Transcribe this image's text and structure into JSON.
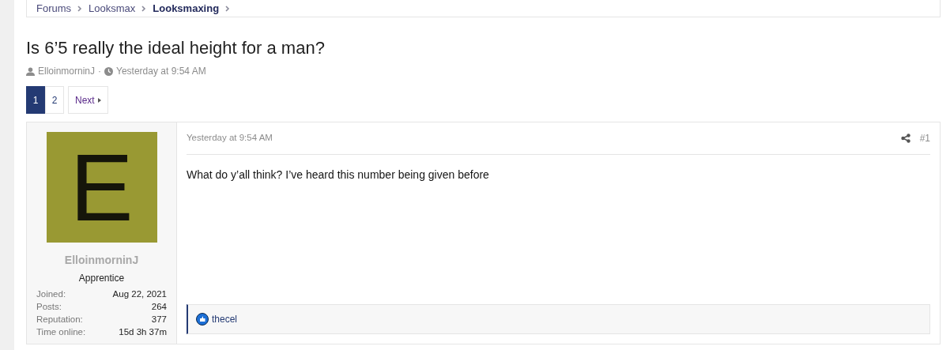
{
  "breadcrumbs": [
    {
      "label": "Forums",
      "selected": false
    },
    {
      "label": "Looksmax",
      "selected": false
    },
    {
      "label": "Looksmaxing",
      "selected": true
    }
  ],
  "thread": {
    "title": "Is 6’5 really the ideal height for a man?",
    "author": "ElloinmorninJ",
    "separator": "·",
    "time": "Yesterday at 9:54 AM"
  },
  "pagination": {
    "pages": [
      {
        "label": "1",
        "selected": true
      },
      {
        "label": "2",
        "selected": false
      }
    ],
    "next": "Next"
  },
  "post": {
    "user": {
      "avatar_letter": "E",
      "name": "ElloinmorninJ",
      "title": "Apprentice",
      "stats": [
        {
          "label": "Joined:",
          "value": "Aug 22, 2021"
        },
        {
          "label": "Posts:",
          "value": "264"
        },
        {
          "label": "Reputation:",
          "value": "377"
        },
        {
          "label": "Time online:",
          "value": "15d 3h 37m"
        }
      ]
    },
    "time": "Yesterday at 9:54 AM",
    "number": "#1",
    "body": "What do y’all think? I’ve heard this number being given before",
    "reactions": [
      "thecel"
    ]
  }
}
